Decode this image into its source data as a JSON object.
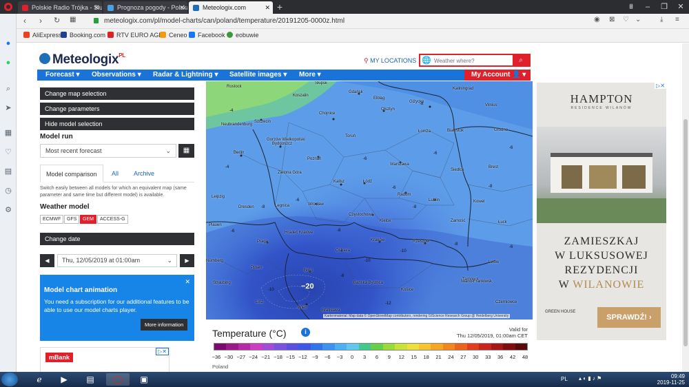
{
  "browser": {
    "tabs": [
      {
        "title": "Polskie Radio Trójka - Słuc",
        "color": "#e0202a"
      },
      {
        "title": "Prognoza pogody - Polska",
        "color": "#4aa0e0"
      },
      {
        "title": "Meteologix.com",
        "color": "#1f6fb8"
      }
    ],
    "url": "meteologix.com/pl/model-charts/can/poland/temperature/20191205-0000z.html",
    "bookmarks": [
      "AliExpress",
      "Booking.com",
      "RTV EURO AGD",
      "Ceneo",
      "Facebook",
      "eobuwie"
    ]
  },
  "site": {
    "logo": "Meteologix",
    "logo_suffix": "PL",
    "my_locations": "MY LOCATIONS",
    "search_placeholder": "Weather where?",
    "menu": [
      "Forecast ▾",
      "Observations ▾",
      "Radar & Lightning ▾",
      "Satellite images ▾",
      "More ▾"
    ],
    "my_account": "My Account 👤 ▾"
  },
  "panel": {
    "change_map": "Change map selection",
    "change_params": "Change parameters",
    "hide_model": "Hide model selection",
    "model_run_heading": "Model run",
    "model_run_value": "Most recent forecast",
    "tabs": [
      "Model comparison",
      "All",
      "Archive"
    ],
    "tab_desc": "Switch easily between all models for which an equivalent map (same parameter and same time but different model) is available.",
    "weather_model_heading": "Weather model",
    "models": [
      "ECMWF",
      "GFS",
      "GEM",
      "ACCESS-G"
    ],
    "active_model": "GEM",
    "change_date": "Change date",
    "date_value": "Thu, 12/05/2019 at 01:00am",
    "anim_title": "Model chart animation",
    "anim_text": "You need a subscription for our additional features to be able to use our model charts player.",
    "anim_more": "More information",
    "mbank": "mBank"
  },
  "map": {
    "cities": [
      "Gdańsk",
      "Koszalin",
      "Słupsk",
      "Rostock",
      "Olsztyn",
      "Giżycko",
      "Elbląg",
      "Kaliningrad",
      "Vilnius",
      "Neubrandenburg",
      "Szczecin",
      "Chojnice",
      "Bydgoszcz",
      "Toruń",
      "Łomża",
      "Białystok",
      "Grodno",
      "Gorzów Wielkopolski",
      "Berlin",
      "Poznań",
      "Warszawa",
      "Siedlce",
      "Brest",
      "Zielona Góra",
      "Kalisz",
      "Łódź",
      "Radom",
      "Lublin",
      "Kowel",
      "Leipzig",
      "Dresden",
      "Legnica",
      "Wrocław",
      "Częstochowa",
      "Kielce",
      "Zamość",
      "Łuck",
      "Hradec Králové",
      "Kraków",
      "Rzeszów",
      "Lwów",
      "Plauen",
      "Praga",
      "Ostrava",
      "Tarnopol",
      "Pilsen",
      "Brno",
      "Banská Bystrica",
      "Košice",
      "Iwano-Frankiwsk",
      "Straubing",
      "Linz",
      "Wien",
      "Bratislava",
      "Czerniowce",
      "Nürnberg"
    ],
    "temps": [
      "-4",
      "-6",
      "-6",
      "-6",
      "-8",
      "-6",
      "-8",
      "-6",
      "-8",
      "-8",
      "-8",
      "-10",
      "-6",
      "-8",
      "-8",
      "-10",
      "-6",
      "-12",
      "-10",
      "-4"
    ],
    "center_temp": "−20",
    "attribution": "Kartenmaterial: Map data © OpenStreetMap contributors, rendering GIScience Research Group @ Heidelberg University"
  },
  "legend": {
    "title": "Temperature (°C)",
    "valid_label": "Valid for",
    "valid_value": "Thu 12/05/2019, 01:00am CET",
    "ticks": [
      "−36",
      "−30",
      "−27",
      "−24",
      "−21",
      "−18",
      "−15",
      "−12",
      "−9",
      "−6",
      "−3",
      "0",
      "3",
      "6",
      "9",
      "12",
      "15",
      "18",
      "21",
      "24",
      "27",
      "30",
      "33",
      "36",
      "42",
      "48"
    ],
    "colors": [
      "#7a0a6e",
      "#9b1a8a",
      "#b62aa8",
      "#cf3cc4",
      "#a44ad8",
      "#7b4fe0",
      "#5a4fe0",
      "#3f57e8",
      "#2f74ef",
      "#3a92f2",
      "#4bb0f4",
      "#62c8f0",
      "#44c98c",
      "#66d04a",
      "#9adb3c",
      "#c8e23a",
      "#eee03a",
      "#f6c52e",
      "#f5a623",
      "#f3871e",
      "#ee631c",
      "#e23c1c",
      "#c8241c",
      "#a61616",
      "#7e0e0e",
      "#5a0808"
    ],
    "country": "Poland"
  },
  "ad": {
    "brand": "HAMPTON",
    "brand_sub": "RESIDENCE WILANÓW",
    "slogan_1": "ZAMIESZKAJ",
    "slogan_2": "W LUKSUSOWEJ",
    "slogan_3": "REZYDENCJI",
    "slogan_4a": "W ",
    "slogan_4b": "WILANOWIE",
    "developer": "GREEN HOUSE",
    "cta": "SPRAWDŹ! ›"
  },
  "taskbar": {
    "lang": "PL",
    "time": "09:49",
    "date": "2019-11-25"
  }
}
